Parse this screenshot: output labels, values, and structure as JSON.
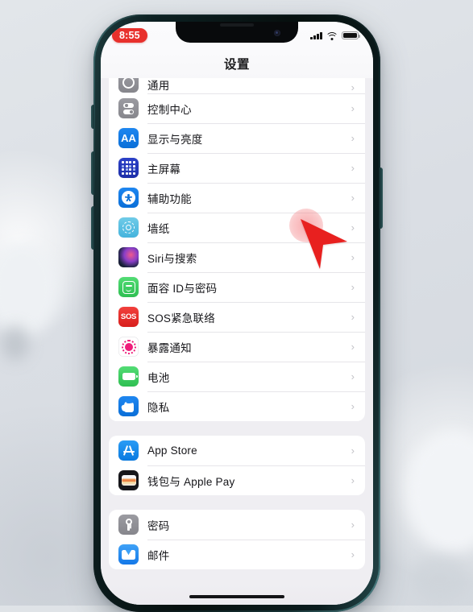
{
  "status_bar": {
    "recording_time": "8:55",
    "signal_icon": "cellular-signal-icon",
    "wifi_icon": "wifi-icon",
    "battery_icon": "battery-icon"
  },
  "nav": {
    "title": "设置"
  },
  "groups": [
    {
      "id": "system-group",
      "clipped_top": true,
      "rows": [
        {
          "label": "通用",
          "icon": "general-gear-icon",
          "icon_class": "ic-general",
          "partial": true
        },
        {
          "label": "控制中心",
          "icon": "control-center-icon",
          "icon_class": "ic-control"
        },
        {
          "label": "显示与亮度",
          "icon": "display-brightness-icon",
          "icon_class": "ic-display"
        },
        {
          "label": "主屏幕",
          "icon": "home-screen-icon",
          "icon_class": "ic-home"
        },
        {
          "label": "辅助功能",
          "icon": "accessibility-icon",
          "icon_class": "ic-access"
        },
        {
          "label": "墙纸",
          "icon": "wallpaper-icon",
          "icon_class": "ic-wall"
        },
        {
          "label": "Siri与搜索",
          "icon": "siri-search-icon",
          "icon_class": "ic-siri"
        },
        {
          "label": "面容 ID与密码",
          "icon": "face-id-icon",
          "icon_class": "ic-faceid"
        },
        {
          "label": "SOS紧急联络",
          "icon": "emergency-sos-icon",
          "icon_class": "ic-sos"
        },
        {
          "label": "暴露通知",
          "icon": "exposure-notification-icon",
          "icon_class": "ic-exposure"
        },
        {
          "label": "电池",
          "icon": "battery-settings-icon",
          "icon_class": "ic-battery"
        },
        {
          "label": "隐私",
          "icon": "privacy-hand-icon",
          "icon_class": "ic-privacy"
        }
      ]
    },
    {
      "id": "store-group",
      "clipped_top": false,
      "rows": [
        {
          "label": "App Store",
          "icon": "app-store-icon",
          "icon_class": "ic-appstore"
        },
        {
          "label": "钱包与 Apple Pay",
          "icon": "wallet-icon",
          "icon_class": "ic-wallet"
        }
      ]
    },
    {
      "id": "accounts-group",
      "clipped_top": false,
      "rows": [
        {
          "label": "密码",
          "icon": "passwords-key-icon",
          "icon_class": "ic-password"
        },
        {
          "label": "邮件",
          "icon": "mail-icon",
          "icon_class": "ic-mail"
        }
      ]
    }
  ],
  "chevron_glyph": "›",
  "cursor": {
    "name": "red-pointer-cursor",
    "tap_target": "辅助功能",
    "color": "#e8201f",
    "halo_color": "#f36a70"
  },
  "device": {
    "frame_color": "#0c1f21",
    "accent_rim_color": "#3d6f72",
    "home_indicator": "home-indicator"
  },
  "colors": {
    "accent_blue": "#0a6fd8",
    "recording_red": "#e8302c",
    "screen_bg": "#efeef2",
    "row_bg": "#ffffff"
  }
}
